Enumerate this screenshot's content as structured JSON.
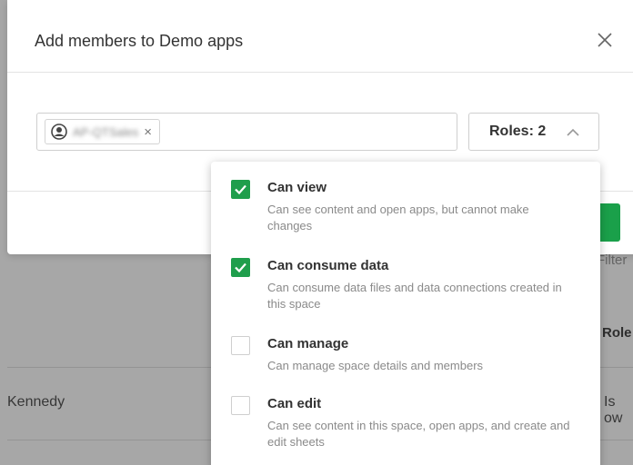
{
  "modal": {
    "title": "Add members to Demo apps",
    "close_icon": "close-icon"
  },
  "member_input": {
    "chip": {
      "icon": "user-group-icon",
      "label": "AP-QTSales",
      "remove_symbol": "×"
    }
  },
  "roles_button": {
    "label": "Roles: 2",
    "chevron_icon": "chevron-up-icon"
  },
  "roles_options": [
    {
      "title": "Can view",
      "description": "Can see content and open apps, but cannot make changes",
      "checked": true
    },
    {
      "title": "Can consume data",
      "description": "Can consume data files and data connections created in this space",
      "checked": true
    },
    {
      "title": "Can manage",
      "description": "Can manage space details and members",
      "checked": false
    },
    {
      "title": "Can edit",
      "description": "Can see content in this space, open apps, and create and edit sheets",
      "checked": false
    }
  ],
  "background": {
    "filter_placeholder": "Filter",
    "role_column_header": "Role",
    "row_name": "Kennedy",
    "row_role": "Is ow"
  },
  "colors": {
    "accent_green": "#1f9e4c",
    "overlay": "#5a5a5a"
  }
}
